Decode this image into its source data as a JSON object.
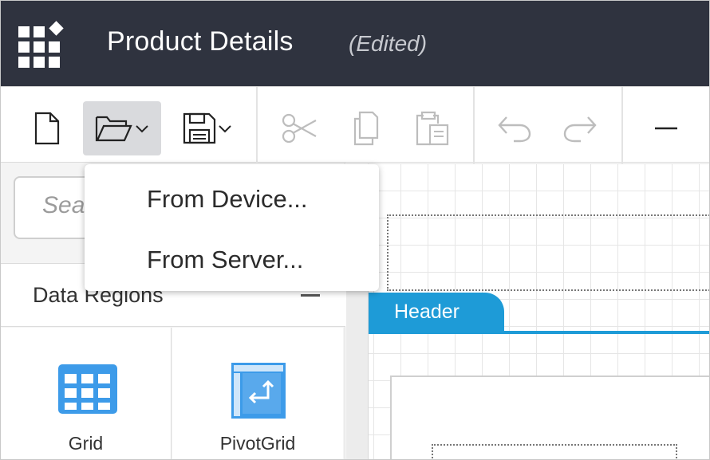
{
  "app": {
    "title": "Product Details",
    "status": "(Edited)",
    "logo_icon": "app-grid-diamond-icon"
  },
  "toolbar": {
    "buttons": [
      {
        "name": "new-file",
        "icon": "file-icon",
        "enabled": true
      },
      {
        "name": "open",
        "icon": "folder-open-icon",
        "has_dropdown": true,
        "active": true
      },
      {
        "name": "save",
        "icon": "save-icon",
        "has_dropdown": true
      },
      {
        "name": "cut",
        "icon": "scissors-icon",
        "enabled": false
      },
      {
        "name": "copy",
        "icon": "copy-icon",
        "enabled": false
      },
      {
        "name": "paste",
        "icon": "paste-icon",
        "enabled": false
      },
      {
        "name": "undo",
        "icon": "undo-icon",
        "enabled": false
      },
      {
        "name": "redo",
        "icon": "redo-icon",
        "enabled": false
      },
      {
        "name": "zoom-out",
        "icon": "minus-icon",
        "enabled": true
      }
    ]
  },
  "open_menu": {
    "items": [
      {
        "label": "From Device..."
      },
      {
        "label": "From Server..."
      }
    ]
  },
  "left_panel": {
    "search_placeholder": "Sea",
    "section_title": "Data Regions",
    "items": [
      {
        "label": "Grid",
        "icon": "grid-table-icon"
      },
      {
        "label": "PivotGrid",
        "icon": "pivot-grid-icon"
      }
    ]
  },
  "canvas": {
    "header_tab_label": "Header"
  },
  "colors": {
    "titlebar": "#2f333f",
    "accent": "#1e9bd7",
    "icon_blue": "#3d9be9"
  }
}
